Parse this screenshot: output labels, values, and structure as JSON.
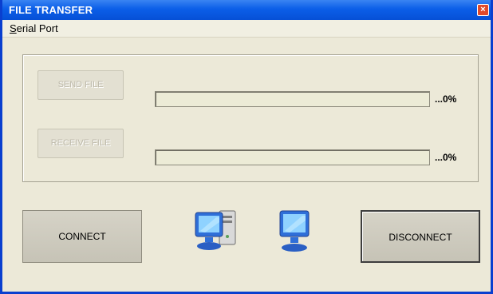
{
  "window": {
    "title": "FILE TRANSFER",
    "close_glyph": "×"
  },
  "menu": {
    "serial_port": {
      "mnemonic": "S",
      "rest": "erial Port"
    }
  },
  "send": {
    "button_label": "SEND FILE",
    "progress_text": "...0%",
    "progress_value": 0
  },
  "receive": {
    "button_label": "RECEIVE FILE",
    "progress_text": "...0%",
    "progress_value": 0
  },
  "actions": {
    "connect_label": "CONNECT",
    "disconnect_label": "DISCONNECT"
  },
  "icons": {
    "left": "computer-tower-icon",
    "right": "monitor-icon"
  },
  "colors": {
    "titlebar": "#0b5ee8",
    "window_bg": "#ece9d8",
    "progress_trough": "#ecebd6"
  }
}
